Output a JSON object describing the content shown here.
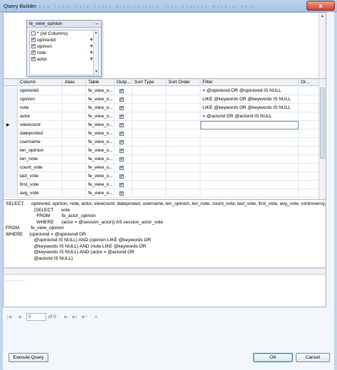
{
  "window": {
    "title": "Query Builder",
    "ghost_menu": "Build Debug Team Data Tools Architecture Test Analyze Window Help",
    "close_glyph": "x"
  },
  "diagram": {
    "table_name": "fe_view_opinion",
    "minimize_glyph": "–",
    "columns": [
      {
        "label": "* (All Columns)",
        "checked": false
      },
      {
        "label": "opinionid",
        "checked": true,
        "filter": true
      },
      {
        "label": "opinion",
        "checked": true,
        "filter": true
      },
      {
        "label": "note",
        "checked": true,
        "filter": true
      },
      {
        "label": "actor",
        "checked": true,
        "filter": true
      }
    ]
  },
  "grid": {
    "headers": [
      "Column",
      "Alias",
      "Table",
      "Outp...",
      "Sort Type",
      "Sort Order",
      "Filter",
      "Or..."
    ],
    "rows": [
      {
        "column": "opinionid",
        "table": "fe_view_o...",
        "output": true,
        "filter": "= @opinionid OR @opinionid IS NULL"
      },
      {
        "column": "opinion",
        "table": "fe_view_o...",
        "output": true,
        "filter": "LIKE @keywords OR @keywords IS NULL"
      },
      {
        "column": "note",
        "table": "fe_view_o...",
        "output": true,
        "filter": "LIKE @keywords OR @keywords IS NULL"
      },
      {
        "column": "actor",
        "table": "fe_view_o...",
        "output": true,
        "filter": "= @actorid OR @actorid IS NULL"
      },
      {
        "column": "viewcount",
        "table": "fe_view_o...",
        "output": true,
        "filter": "",
        "current": true
      },
      {
        "column": "dateposted",
        "table": "fe_view_o...",
        "output": true,
        "filter": ""
      },
      {
        "column": "username",
        "table": "fe_view_o...",
        "output": true,
        "filter": ""
      },
      {
        "column": "len_opinion",
        "table": "fe_view_o...",
        "output": true,
        "filter": ""
      },
      {
        "column": "len_note",
        "table": "fe_view_o...",
        "output": true,
        "filter": ""
      },
      {
        "column": "count_vote",
        "table": "fe_view_o...",
        "output": true,
        "filter": ""
      },
      {
        "column": "last_vote",
        "table": "fe_view_o...",
        "output": true,
        "filter": ""
      },
      {
        "column": "first_vote",
        "table": "fe_view_o...",
        "output": true,
        "filter": ""
      },
      {
        "column": "avg_vote",
        "table": "fe_view_o...",
        "output": true,
        "filter": ""
      }
    ],
    "current_marker": "▶"
  },
  "sql": {
    "text": "SELECT      opinionid, opinion, note, actor, viewcount, dateposted, username, len_opinion, len_note, count_vote, last_vote, first_vote, avg_vote, controversy, newfag\n                      (SELECT      vote\n                        FROM         fe_actor_opinion\n                        WHERE      (actor = @session_actor)) AS session_actor_vote\nFROM         fe_view_opinion\nWHERE     (opinionid = @opinionid OR\n                      @opinionid IS NULL) AND (opinion LIKE @keywords OR\n                      @keywords IS NULL) AND (note LIKE @keywords OR\n                      @keywords IS NULL) AND (actor = @actorid OR\n                      @actorid IS NULL)"
  },
  "navigation": {
    "first": "|◀",
    "prev": "◀",
    "record_value": "0",
    "of_label": "of 0",
    "next": "▶",
    "last": "▶|",
    "new": "▶*",
    "stop": "●"
  },
  "buttons": {
    "execute": "Execute Query",
    "ok": "OK",
    "cancel": "Cancel"
  }
}
